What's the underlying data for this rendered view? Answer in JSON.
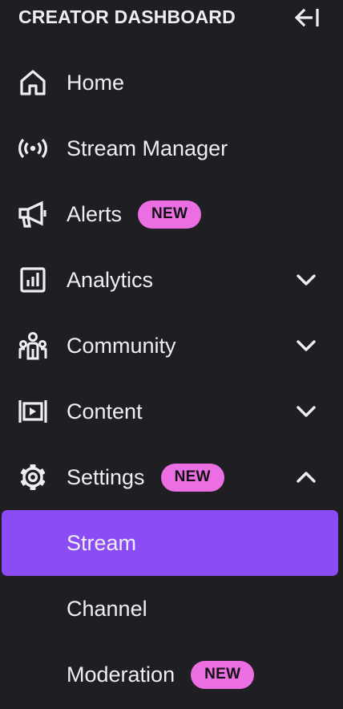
{
  "header": {
    "title": "CREATOR DASHBOARD",
    "collapse_icon": "collapse-left-icon"
  },
  "colors": {
    "background": "#1f1f23",
    "text": "#efeff1",
    "badge": "#eb6ee3",
    "active": "#8b4bf5"
  },
  "nav": {
    "home": {
      "label": "Home",
      "icon": "home-icon"
    },
    "stream_manager": {
      "label": "Stream Manager",
      "icon": "broadcast-icon"
    },
    "alerts": {
      "label": "Alerts",
      "icon": "megaphone-icon",
      "badge": "NEW"
    },
    "analytics": {
      "label": "Analytics",
      "icon": "analytics-icon",
      "expanded": false
    },
    "community": {
      "label": "Community",
      "icon": "community-icon",
      "expanded": false
    },
    "content": {
      "label": "Content",
      "icon": "video-frame-icon",
      "expanded": false
    },
    "settings": {
      "label": "Settings",
      "icon": "gear-icon",
      "badge": "NEW",
      "expanded": true,
      "children": {
        "stream": {
          "label": "Stream",
          "active": true
        },
        "channel": {
          "label": "Channel",
          "active": false
        },
        "moderation": {
          "label": "Moderation",
          "badge": "NEW",
          "active": false
        }
      }
    }
  }
}
